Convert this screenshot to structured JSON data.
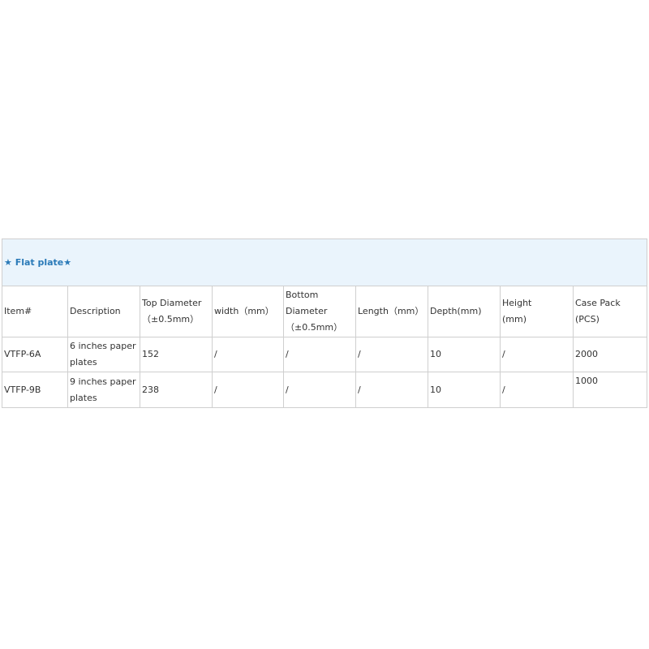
{
  "table": {
    "title": "★ Flat plate★",
    "headers": [
      "Item#",
      "Description",
      "Top Diameter\n（±0.5mm）",
      "width（mm）",
      "Bottom Diameter\n（±0.5mm）",
      "Length（mm）",
      "Depth(mm)",
      "Height\n(mm)",
      "Case Pack\n(PCS)"
    ],
    "rows": [
      [
        "VTFP-6A",
        "6 inches paper plates",
        "152",
        "/",
        "/",
        "/",
        "10",
        "/",
        "2000"
      ],
      [
        "VTFP-9B",
        "9 inches paper plates",
        "238",
        "/",
        "/",
        "/",
        "10",
        "/",
        "1000"
      ]
    ]
  }
}
